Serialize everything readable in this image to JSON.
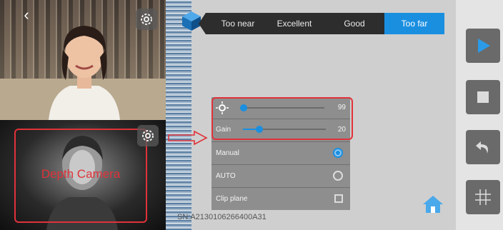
{
  "left_panel": {
    "depth_label": "Depth Camera"
  },
  "range_selector": {
    "options": [
      {
        "label": "Too near",
        "active": false
      },
      {
        "label": "Excellent",
        "active": false
      },
      {
        "label": "Good",
        "active": false
      },
      {
        "label": "Too far",
        "active": true
      }
    ]
  },
  "settings_panel": {
    "exposure": {
      "icon": "sun-icon",
      "value": "99",
      "level": 0.05
    },
    "gain": {
      "label": "Gain",
      "value": "20",
      "level": 0.22
    },
    "options": [
      {
        "label": "Manual",
        "control": "radio",
        "checked": true
      },
      {
        "label": "AUTO",
        "control": "radio",
        "checked": false
      },
      {
        "label": "Clip plane",
        "control": "checkbox",
        "checked": false
      }
    ]
  },
  "footer": {
    "serial": "SN:A2130106266400A31"
  },
  "side_controls": [
    {
      "icon": "play-icon"
    },
    {
      "icon": "stop-icon"
    },
    {
      "icon": "undo-icon"
    },
    {
      "icon": "grid-icon"
    }
  ],
  "colors": {
    "accent": "#1a8fe0",
    "highlight": "#e0323a"
  }
}
